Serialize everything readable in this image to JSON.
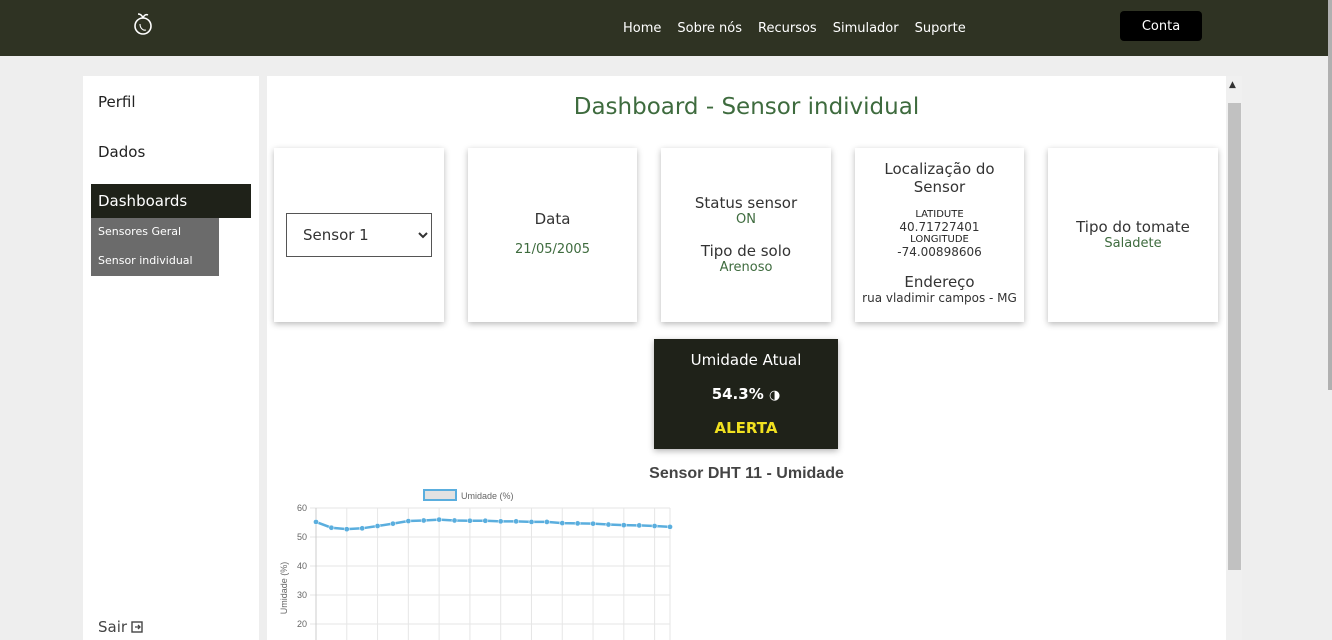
{
  "nav": {
    "links": [
      "Home",
      "Sobre nós",
      "Recursos",
      "Simulador",
      "Suporte"
    ],
    "account_button": "Conta"
  },
  "sidebar": {
    "items": [
      {
        "label": "Perfil"
      },
      {
        "label": "Dados"
      },
      {
        "label": "Dashboards"
      }
    ],
    "subitems": [
      {
        "label": "Sensores Geral"
      },
      {
        "label": "Sensor individual"
      }
    ],
    "logout": "Sair"
  },
  "main": {
    "title": "Dashboard - Sensor individual",
    "sensor_select": {
      "selected": "Sensor 1",
      "options": [
        "Sensor 1"
      ]
    },
    "date_card": {
      "label": "Data",
      "value": "21/05/2005"
    },
    "status_card": {
      "status_label": "Status sensor",
      "status_value": "ON",
      "soil_label": "Tipo de solo",
      "soil_value": "Arenoso"
    },
    "location_card": {
      "title_line1": "Localização do",
      "title_line2": "Sensor",
      "lat_label": "LATIDUTE",
      "lat_value": "40.71727401",
      "lon_label": "LONGITUDE",
      "lon_value": "-74.00898606",
      "address_label": "Endereço",
      "address_value": "rua vladimir campos - MG"
    },
    "tomato_card": {
      "label": "Tipo do tomate",
      "value": "Saladete"
    },
    "humidity": {
      "label": "Umidade Atual",
      "value": "54.3%",
      "alert": "ALERTA"
    }
  },
  "chart_data": {
    "type": "line",
    "title": "Sensor DHT 11 - Umidade",
    "ylabel": "Umidade (%)",
    "xlabel": "",
    "ylim": [
      0,
      60
    ],
    "yticks": [
      20,
      30,
      40,
      50,
      60
    ],
    "series": [
      {
        "name": "Umidade (%)",
        "color": "#5aaede",
        "values": [
          55.2,
          53.2,
          52.7,
          53.0,
          53.8,
          54.6,
          55.5,
          55.7,
          56.0,
          55.7,
          55.6,
          55.6,
          55.4,
          55.4,
          55.2,
          55.2,
          54.8,
          54.7,
          54.6,
          54.3,
          54.1,
          54.0,
          53.8,
          53.5
        ]
      }
    ]
  },
  "colors": {
    "topbar": "#2f3323",
    "accent_green": "#3e6b3e",
    "dark_panel": "#1f2219",
    "alert_yellow": "#f0e020"
  }
}
